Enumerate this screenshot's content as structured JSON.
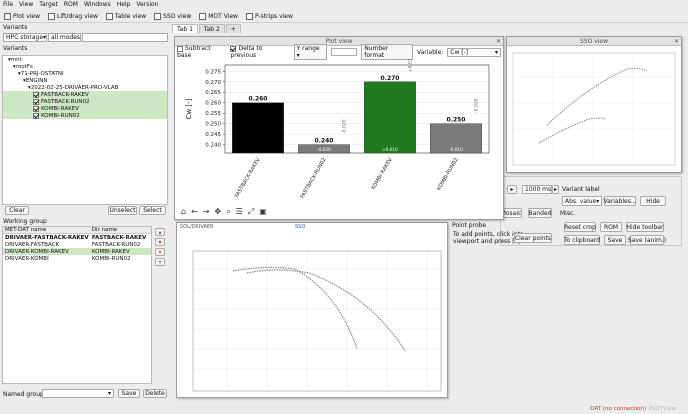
{
  "menu": [
    "File",
    "View",
    "Target",
    "ROM",
    "Windows",
    "Help",
    "Version"
  ],
  "toolbar": [
    {
      "label": "Plot view",
      "icon": "plot-view-icon"
    },
    {
      "label": "Lift/drag view",
      "icon": "lift-drag-icon"
    },
    {
      "label": "Table view",
      "icon": "table-view-icon"
    },
    {
      "label": "SSO view",
      "icon": "sso-view-icon"
    },
    {
      "label": "MOT View",
      "icon": "mot-view-icon"
    },
    {
      "label": "P-strips view",
      "icon": "pstrips-view-icon"
    }
  ],
  "tabs": [
    "Tab 1",
    "Tab 2",
    "+"
  ],
  "variants": {
    "title": "Variants",
    "storage": "HPC storage",
    "mode": "all modes",
    "tree": [
      {
        "label": "mnt",
        "indent": 1,
        "checked": null
      },
      {
        "label": "rootFs",
        "indent": 2,
        "checked": null
      },
      {
        "label": "71-PRJ-OSTATNI",
        "indent": 3,
        "checked": null
      },
      {
        "label": "ENGINN",
        "indent": 4,
        "checked": null
      },
      {
        "label": "2022-02-25-DRIVAER-PRO-VLAB",
        "indent": 5,
        "checked": null
      },
      {
        "label": "FASTBACK-RAKEV",
        "indent": 6,
        "checked": true
      },
      {
        "label": "FASTBACK-RUN02",
        "indent": 6,
        "checked": true
      },
      {
        "label": "KOMBI-RAKEV",
        "indent": 6,
        "checked": true
      },
      {
        "label": "KOMBI-RUN02",
        "indent": 6,
        "checked": true
      }
    ],
    "clear": "Clear",
    "unselect": "Unselect",
    "select": "Select"
  },
  "working_group": {
    "title": "Working group",
    "headers": [
      "MET-DAT name",
      "Dir name"
    ],
    "rows": [
      {
        "name": "DRIVAER-FASTBACK-RAKEV",
        "dir": "FASTBACK-RAKEV",
        "bold": true
      },
      {
        "name": "DRIVAER-FASTBACK",
        "dir": "FASTBACK-RUN02",
        "bold": false
      },
      {
        "name": "DRIVAER-KOMBI-RAKEV",
        "dir": "KOMBI-RAKEV",
        "bold": false
      },
      {
        "name": "DRIVAER-KOMBI",
        "dir": "KOMBI-RUN02",
        "bold": false
      }
    ],
    "named_groups_label": "Named groups:",
    "save": "Save",
    "delete": "Delete"
  },
  "plot_window": {
    "title": "Plot view",
    "subtract_base": "Subtract base",
    "delta_to_previous": "Delta to previous",
    "y_range": "Y range",
    "number_format": "Number format",
    "variable_label": "Variable:",
    "variable_value": "Cw [-]"
  },
  "sso_window": {
    "title": "SSO view"
  },
  "right_panel": {
    "time_value": "1000 ms",
    "variant_label": "Variant label",
    "abs_value": "Abs. value",
    "variables": "Variables...",
    "hide": "Hide",
    "mosaic": "Mosaic",
    "banded": "Banded",
    "misc": "Misc.",
    "reset_crop": "Reset crop",
    "rom": "ROM",
    "hide_toolbar": "Hide toolbar",
    "to_clipboard": "To clipboard",
    "save": "Save",
    "save_anim": "Save (anim.)"
  },
  "bottom_plot": {
    "header_left": "SOL/DRIVAER",
    "header_mid": "SSO",
    "point_probe": "Point probe",
    "hint_line1": "To add points, click into",
    "hint_line2": "viewport and press [P]",
    "clear_points": "Clear points"
  },
  "status": {
    "text": "DAT (no connection)",
    "suffix": "PLOTView"
  },
  "chart_data": [
    {
      "type": "bar",
      "categories": [
        "FASTBACK-RAKEV",
        "FASTBACK-RUN02",
        "KOMBI-RAKEV",
        "KOMBI-RUN02"
      ],
      "values": [
        0.26,
        0.24,
        0.27,
        0.25
      ],
      "value_labels": [
        "0.260",
        "0.240",
        "0.270",
        "0.250"
      ],
      "delta_labels": [
        "",
        "-0.020",
        "+0.030",
        "-0.020"
      ],
      "inner_labels": [
        "",
        "-0.020",
        "+0.010",
        "-0.010"
      ],
      "colors": [
        "#000000",
        "#7a7a7a",
        "#1e7a1e",
        "#7a7a7a"
      ],
      "ylabel": "Cw [-]",
      "ylim": [
        0.236,
        0.278
      ],
      "yticks": [
        0.24,
        0.245,
        0.25,
        0.255,
        0.26,
        0.265,
        0.27,
        0.275
      ]
    }
  ]
}
